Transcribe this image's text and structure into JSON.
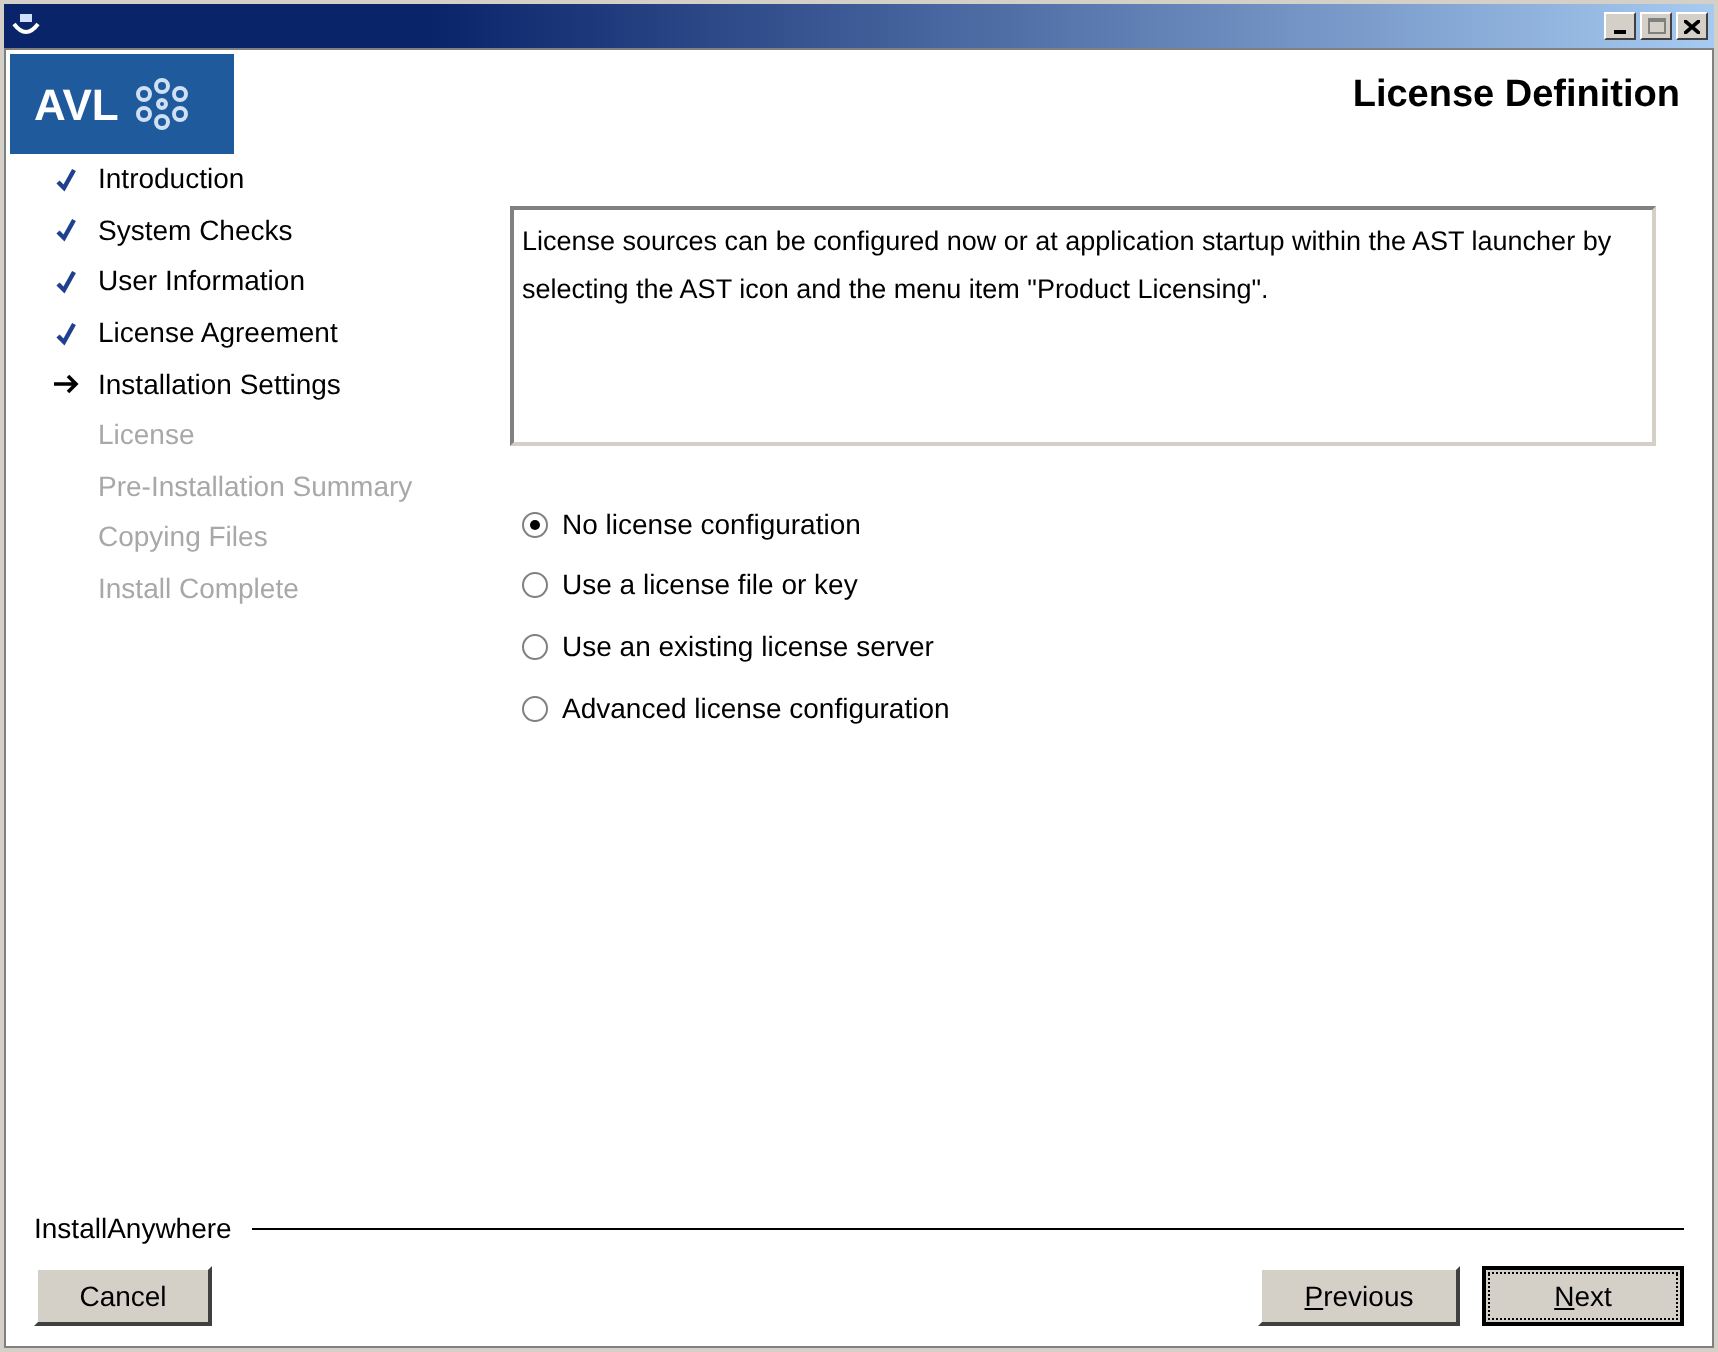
{
  "header": {
    "logo": "AVL",
    "title": "License Definition"
  },
  "steps": [
    {
      "label": "Introduction",
      "kind": "done"
    },
    {
      "label": "System Checks",
      "kind": "done"
    },
    {
      "label": "User Information",
      "kind": "done"
    },
    {
      "label": "License Agreement",
      "kind": "done"
    },
    {
      "label": "Installation Settings",
      "kind": "current"
    },
    {
      "label": "License",
      "kind": "pending"
    },
    {
      "label": "Pre-Installation Summary",
      "kind": "pending"
    },
    {
      "label": "Copying Files",
      "kind": "pending"
    },
    {
      "label": "Install Complete",
      "kind": "pending"
    }
  ],
  "description": "License sources can be configured now or at application startup within the AST launcher by selecting the AST icon and the menu item \"Product Licensing\".",
  "options": [
    {
      "label": "No license configuration",
      "selected": true
    },
    {
      "label": "Use a license file or key",
      "selected": false
    },
    {
      "label": "Use an existing license server",
      "selected": false
    },
    {
      "label": "Advanced license configuration",
      "selected": false
    }
  ],
  "footer": {
    "brand": "InstallAnywhere"
  },
  "buttons": [
    {
      "label": "Cancel",
      "focused": false,
      "mnemonic": false
    },
    {
      "label": "Previous",
      "focused": false,
      "mnemonic": true
    },
    {
      "label": "Next",
      "focused": true,
      "mnemonic": true
    }
  ]
}
